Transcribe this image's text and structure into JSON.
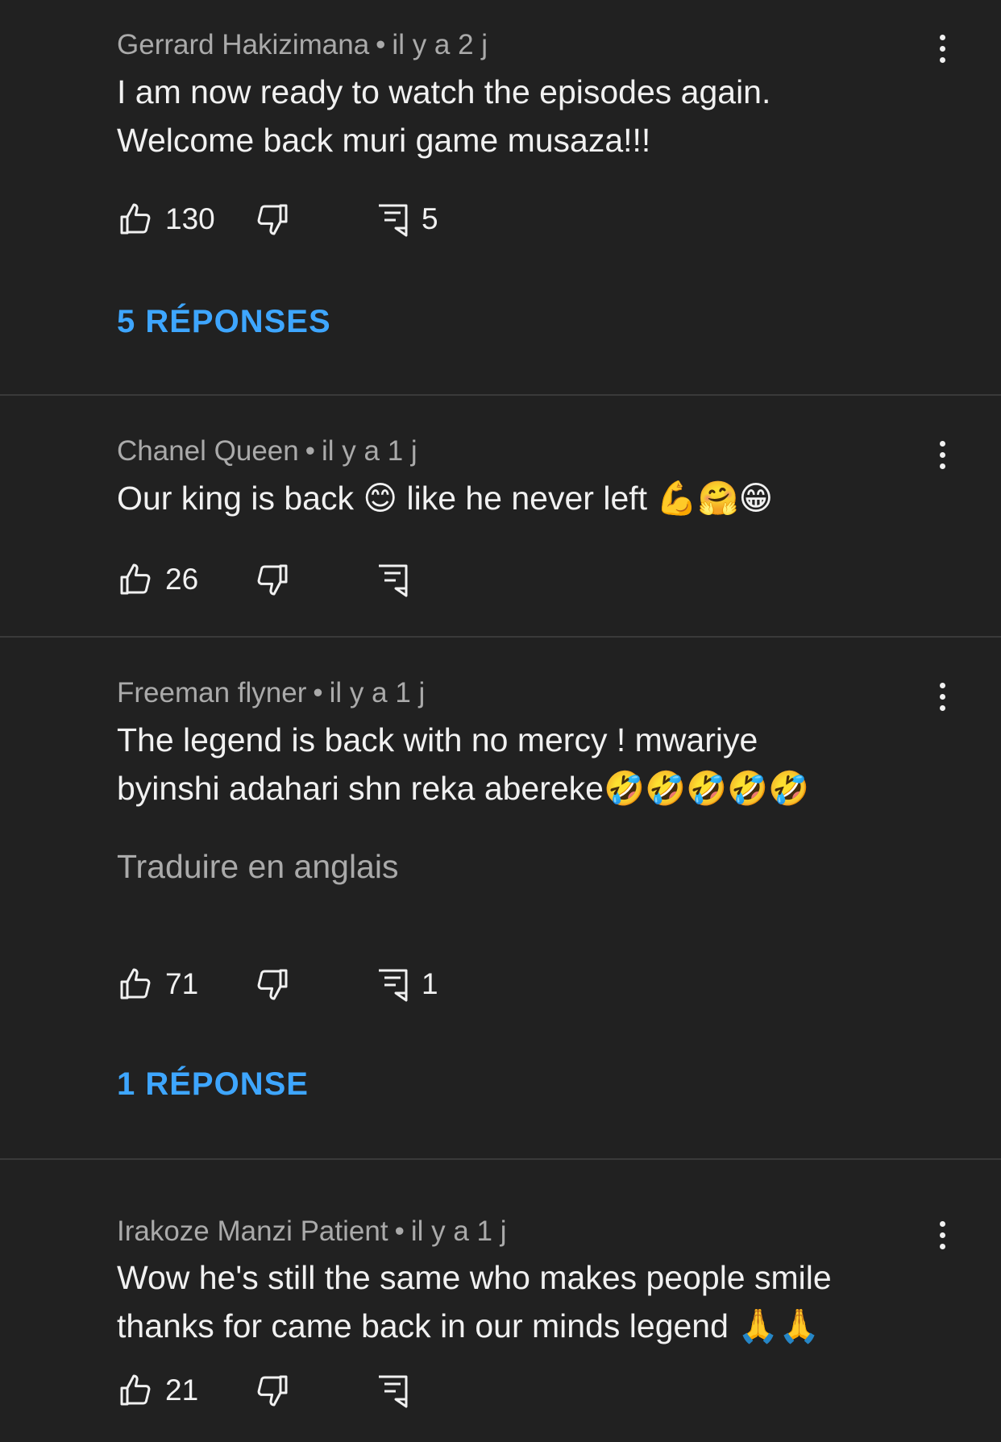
{
  "comments": [
    {
      "author": "Gerrard Hakizimana",
      "time": "il y a 2 j",
      "text_lines": [
        "I am now ready to watch the episodes again.",
        "Welcome back muri game musaza!!!"
      ],
      "likes": "130",
      "replies_count": "5",
      "replies_label": "5 RÉPONSES"
    },
    {
      "author": "Chanel Queen",
      "time": "il y a 1 j",
      "text_lines": [
        "Our king is back 😊 like he never left 💪🤗😁"
      ],
      "likes": "26",
      "replies_count": ""
    },
    {
      "author": "Freeman flyner",
      "time": "il y a 1 j",
      "text_lines": [
        "The legend is back with no mercy !  mwariye",
        "byinshi adahari shn reka abereke🤣🤣🤣🤣🤣"
      ],
      "translate_label": "Traduire en anglais",
      "likes": "71",
      "replies_count": "1",
      "replies_label": "1 RÉPONSE"
    },
    {
      "author": "Irakoze Manzi Patient",
      "time": "il y a 1 j",
      "text_lines": [
        "Wow he's still the same who makes people smile",
        "thanks for came back in our minds  legend 🙏🙏"
      ],
      "likes": "21",
      "replies_count": ""
    }
  ],
  "meta_separator": "•",
  "colors": {
    "background": "#212121",
    "text_primary": "#f1f1f1",
    "text_secondary": "#aaaaaa",
    "link": "#3ea6ff",
    "divider": "#3a3a3a"
  },
  "icons": [
    "thumbs-up-icon",
    "thumbs-down-icon",
    "reply-icon",
    "more-vert-icon"
  ]
}
